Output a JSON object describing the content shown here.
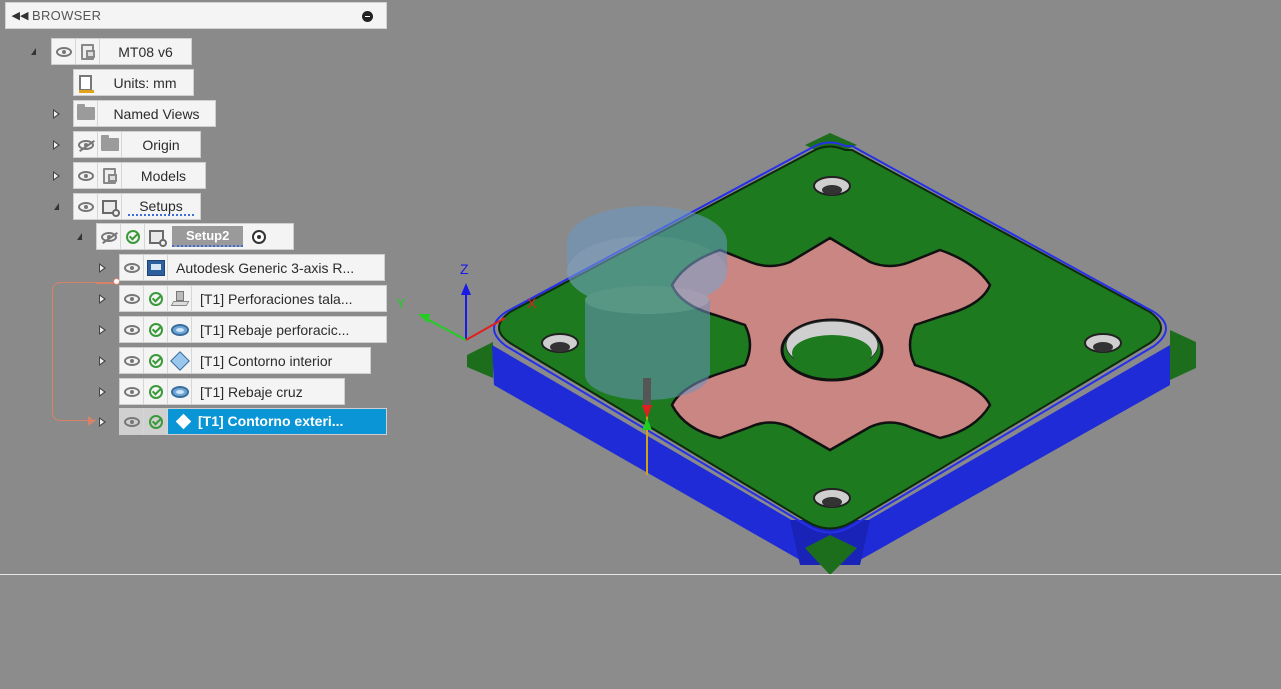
{
  "browser": {
    "title": "BROWSER",
    "collapse_icon": "double-chevron-left-icon",
    "minimize_icon": "minimize-circle-icon"
  },
  "tree": {
    "root": {
      "label": "MT08 v6",
      "icon": "component-icon"
    },
    "units": {
      "label": "Units: mm",
      "icon": "document-units-icon"
    },
    "named_views": {
      "label": "Named Views",
      "icon": "folder-icon"
    },
    "origin": {
      "label": "Origin",
      "icon": "folder-icon",
      "visible": false
    },
    "models": {
      "label": "Models",
      "icon": "component-icon"
    },
    "setups": {
      "label": "Setups",
      "icon": "setup-icon"
    },
    "setup2": {
      "label": "Setup2",
      "icon": "setup-icon",
      "visible": false
    },
    "items": [
      {
        "label": "Autodesk Generic 3-axis R...",
        "icon": "machine-icon"
      },
      {
        "label": "[T1] Perforaciones tala...",
        "icon": "drill-operation-icon"
      },
      {
        "label": "[T1] Rebaje perforacic...",
        "icon": "pocket-operation-icon"
      },
      {
        "label": "[T1] Contorno interior",
        "icon": "contour-operation-icon"
      },
      {
        "label": "[T1] Rebaje cruz",
        "icon": "pocket-operation-icon"
      },
      {
        "label": "[T1] Contorno exteri...",
        "icon": "contour-operation-icon",
        "selected": true
      }
    ]
  },
  "viewport": {
    "axes": {
      "z": "Z",
      "y": "Y",
      "x": "X"
    },
    "colors": {
      "stock_side": "#1f2bd6",
      "part_top": "#1e7a1f",
      "cross_pocket": "#c98683",
      "background": "#8a8a8a"
    }
  }
}
